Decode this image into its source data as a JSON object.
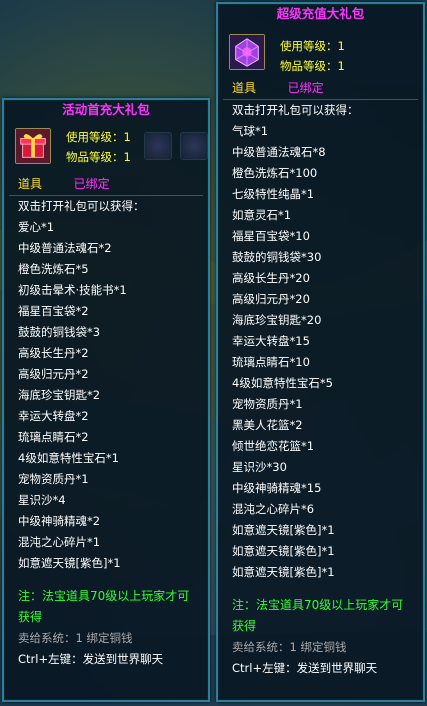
{
  "left": {
    "title": "活动首充大礼包",
    "use_level": "使用等级：1",
    "item_level": "物品等级：1",
    "category": "道具",
    "bound": "已绑定",
    "intro": "双击打开礼包可以获得：",
    "items": [
      "爱心*1",
      "中级普通法魂石*2",
      "橙色洗炼石*5",
      "初级击晕术·技能书*1",
      "福星百宝袋*2",
      "鼓鼓的铜钱袋*3",
      "高级长生丹*2",
      "高级归元丹*2",
      "海底珍宝钥匙*2",
      "幸运大转盘*2",
      "琉璃点睛石*2",
      "4级如意特性宝石*1",
      "宠物资质丹*1",
      "星识沙*4",
      "中级神骑精魂*2",
      "混沌之心碎片*1",
      "如意遮天镜[紫色]*1"
    ],
    "note": "注：法宝道具70级以上玩家才可获得",
    "sell": "卖给系统：1 绑定铜钱",
    "ctrl": "Ctrl+左键：发送到世界聊天"
  },
  "right": {
    "title": "超级充值大礼包",
    "use_level": "使用等级：1",
    "item_level": "物品等级：1",
    "category": "道具",
    "bound": "已绑定",
    "intro": "双击打开礼包可以获得：",
    "items": [
      "气球*1",
      "中级普通法魂石*8",
      "橙色洗炼石*100",
      "七级特性纯晶*1",
      "如意灵石*1",
      "福星百宝袋*10",
      "鼓鼓的铜钱袋*30",
      "高级长生丹*20",
      "高级归元丹*20",
      "海底珍宝钥匙*20",
      "幸运大转盘*15",
      "琉璃点睛石*10",
      "4级如意特性宝石*5",
      "宠物资质丹*1",
      "黑美人花篮*2",
      "倾世绝恋花篮*1",
      "星识沙*30",
      "中级神骑精魂*15",
      "混沌之心碎片*6",
      "如意遮天镜[紫色]*1",
      "如意遮天镜[紫色]*1",
      "如意遮天镜[紫色]*1"
    ],
    "note": "注：法宝道具70级以上玩家才可获得",
    "sell": "卖给系统：1 绑定铜钱",
    "ctrl": "Ctrl+左键：发送到世界聊天"
  },
  "icons": {
    "left_item": "red-gift-box-icon",
    "right_item": "purple-crystal-gift-icon"
  }
}
